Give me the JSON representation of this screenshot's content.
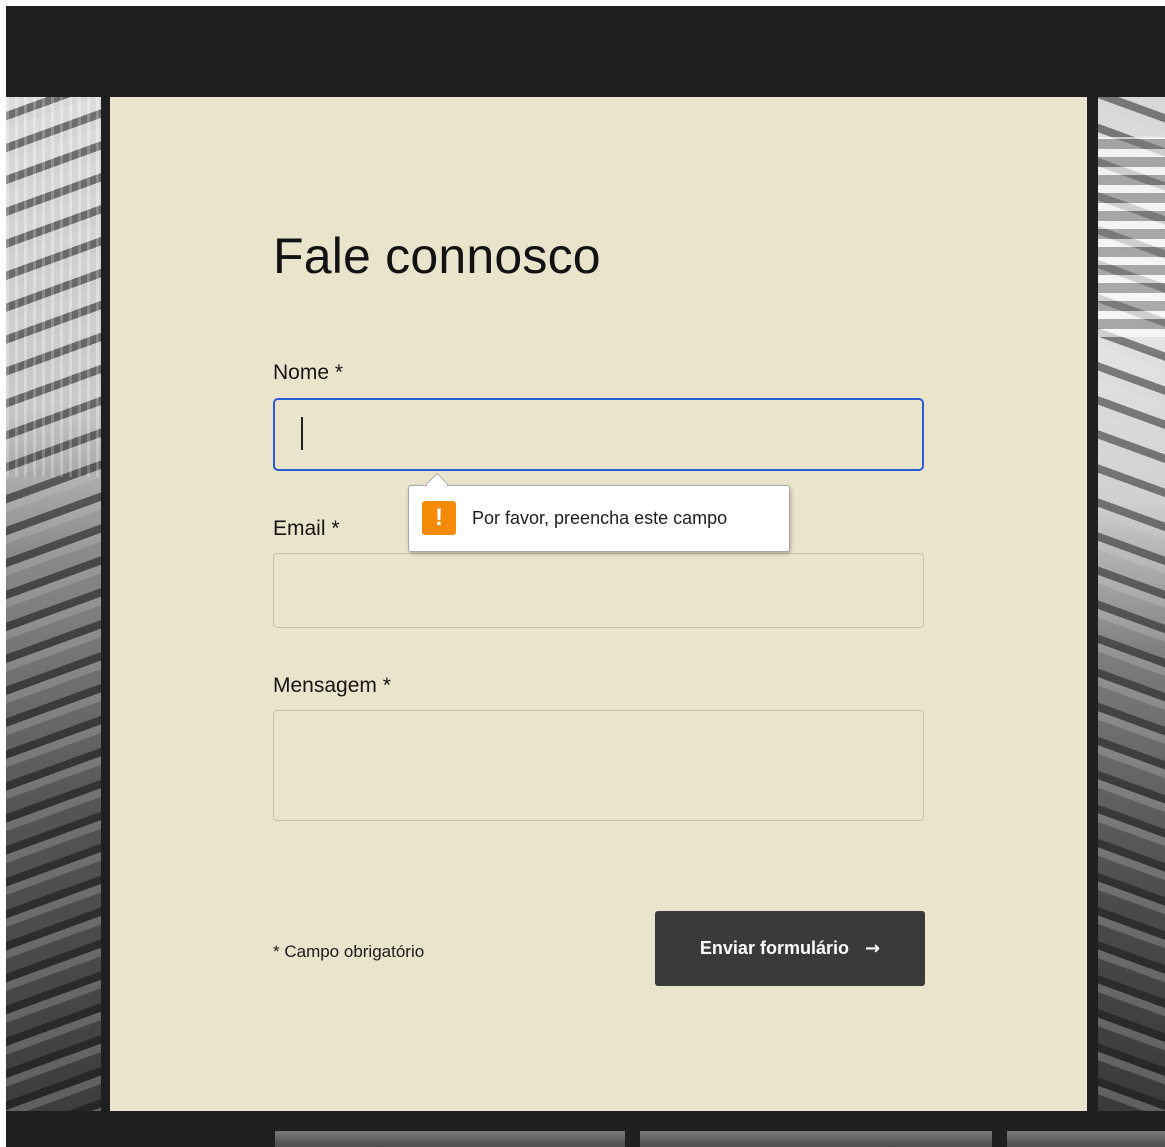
{
  "form": {
    "title": "Fale connosco",
    "fields": [
      {
        "label": "Nome",
        "required_mark": "*",
        "value": ""
      },
      {
        "label": "Email",
        "required_mark": "*",
        "value": ""
      },
      {
        "label": "Mensagem",
        "required_mark": "*",
        "value": ""
      }
    ],
    "required_note": "* Campo obrigatório",
    "submit_label": "Enviar formulário",
    "submit_icon": "arrow-right-icon",
    "submit_arrow": "→"
  },
  "validation_tooltip": {
    "icon": "warning-icon",
    "icon_glyph": "!",
    "message": "Por favor, preencha este campo"
  },
  "colors": {
    "page_background": "#1f1f1f",
    "card_background": "#ebe4cd",
    "focus_border": "#2c5bd6",
    "button_background": "#3a3a3a",
    "warning": "#f58a07"
  }
}
